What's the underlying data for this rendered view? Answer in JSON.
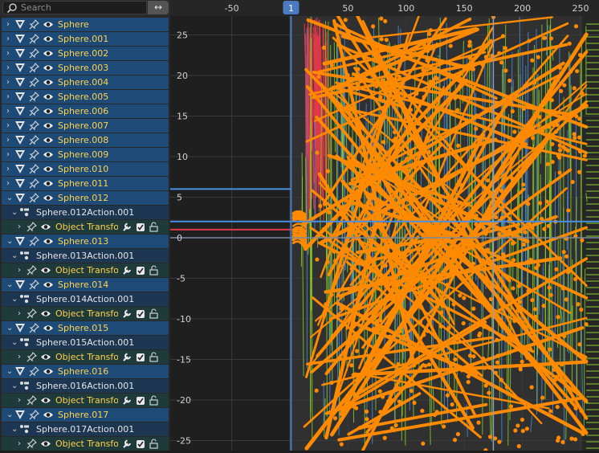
{
  "search": {
    "placeholder": "Search"
  },
  "swap_glyph": "↔",
  "rows": [
    {
      "type": "object",
      "label": "Sphere"
    },
    {
      "type": "object",
      "label": "Sphere.001"
    },
    {
      "type": "object",
      "label": "Sphere.002"
    },
    {
      "type": "object",
      "label": "Sphere.003"
    },
    {
      "type": "object",
      "label": "Sphere.004"
    },
    {
      "type": "object",
      "label": "Sphere.005"
    },
    {
      "type": "object",
      "label": "Sphere.006"
    },
    {
      "type": "object",
      "label": "Sphere.007"
    },
    {
      "type": "object",
      "label": "Sphere.008"
    },
    {
      "type": "object",
      "label": "Sphere.009"
    },
    {
      "type": "object",
      "label": "Sphere.010"
    },
    {
      "type": "object",
      "label": "Sphere.011"
    },
    {
      "type": "object",
      "label": "Sphere.012",
      "expanded": true
    },
    {
      "type": "action",
      "label": "Sphere.012Action.001"
    },
    {
      "type": "fcurve",
      "label": "Object Transforms"
    },
    {
      "type": "object",
      "label": "Sphere.013",
      "expanded": true
    },
    {
      "type": "action",
      "label": "Sphere.013Action.001"
    },
    {
      "type": "fcurve",
      "label": "Object Transforms"
    },
    {
      "type": "object",
      "label": "Sphere.014",
      "expanded": true
    },
    {
      "type": "action",
      "label": "Sphere.014Action.001"
    },
    {
      "type": "fcurve",
      "label": "Object Transforms"
    },
    {
      "type": "object",
      "label": "Sphere.015",
      "expanded": true
    },
    {
      "type": "action",
      "label": "Sphere.015Action.001"
    },
    {
      "type": "fcurve",
      "label": "Object Transforms"
    },
    {
      "type": "object",
      "label": "Sphere.016",
      "expanded": true
    },
    {
      "type": "action",
      "label": "Sphere.016Action.001"
    },
    {
      "type": "fcurve",
      "label": "Object Transforms"
    },
    {
      "type": "object",
      "label": "Sphere.017",
      "expanded": true
    },
    {
      "type": "action",
      "label": "Sphere.017Action.001"
    },
    {
      "type": "fcurve",
      "label": "Object Transforms"
    }
  ],
  "graph": {
    "current_frame": "1",
    "x_ticks": [
      "-50",
      "0",
      "50",
      "100",
      "150",
      "200",
      "250"
    ],
    "x_tick_values": [
      -50,
      0,
      50,
      100,
      150,
      200,
      250
    ],
    "y_ticks": [
      "25",
      "20",
      "15",
      "10",
      "5",
      "0",
      "-5",
      "-10",
      "-15",
      "-20",
      "-25"
    ],
    "y_tick_values": [
      25,
      20,
      15,
      10,
      5,
      0,
      -5,
      -10,
      -15,
      -20,
      -25
    ],
    "colors": {
      "background": "#303030",
      "ruler": "#262626",
      "grid": "#3a3a3a",
      "playhead": "#4a7ac2",
      "curve_orange": "#ff8a00",
      "curve_red": "#e03a4a",
      "curve_green": "#8ad32a",
      "curve_blue": "#4a90e2"
    }
  }
}
